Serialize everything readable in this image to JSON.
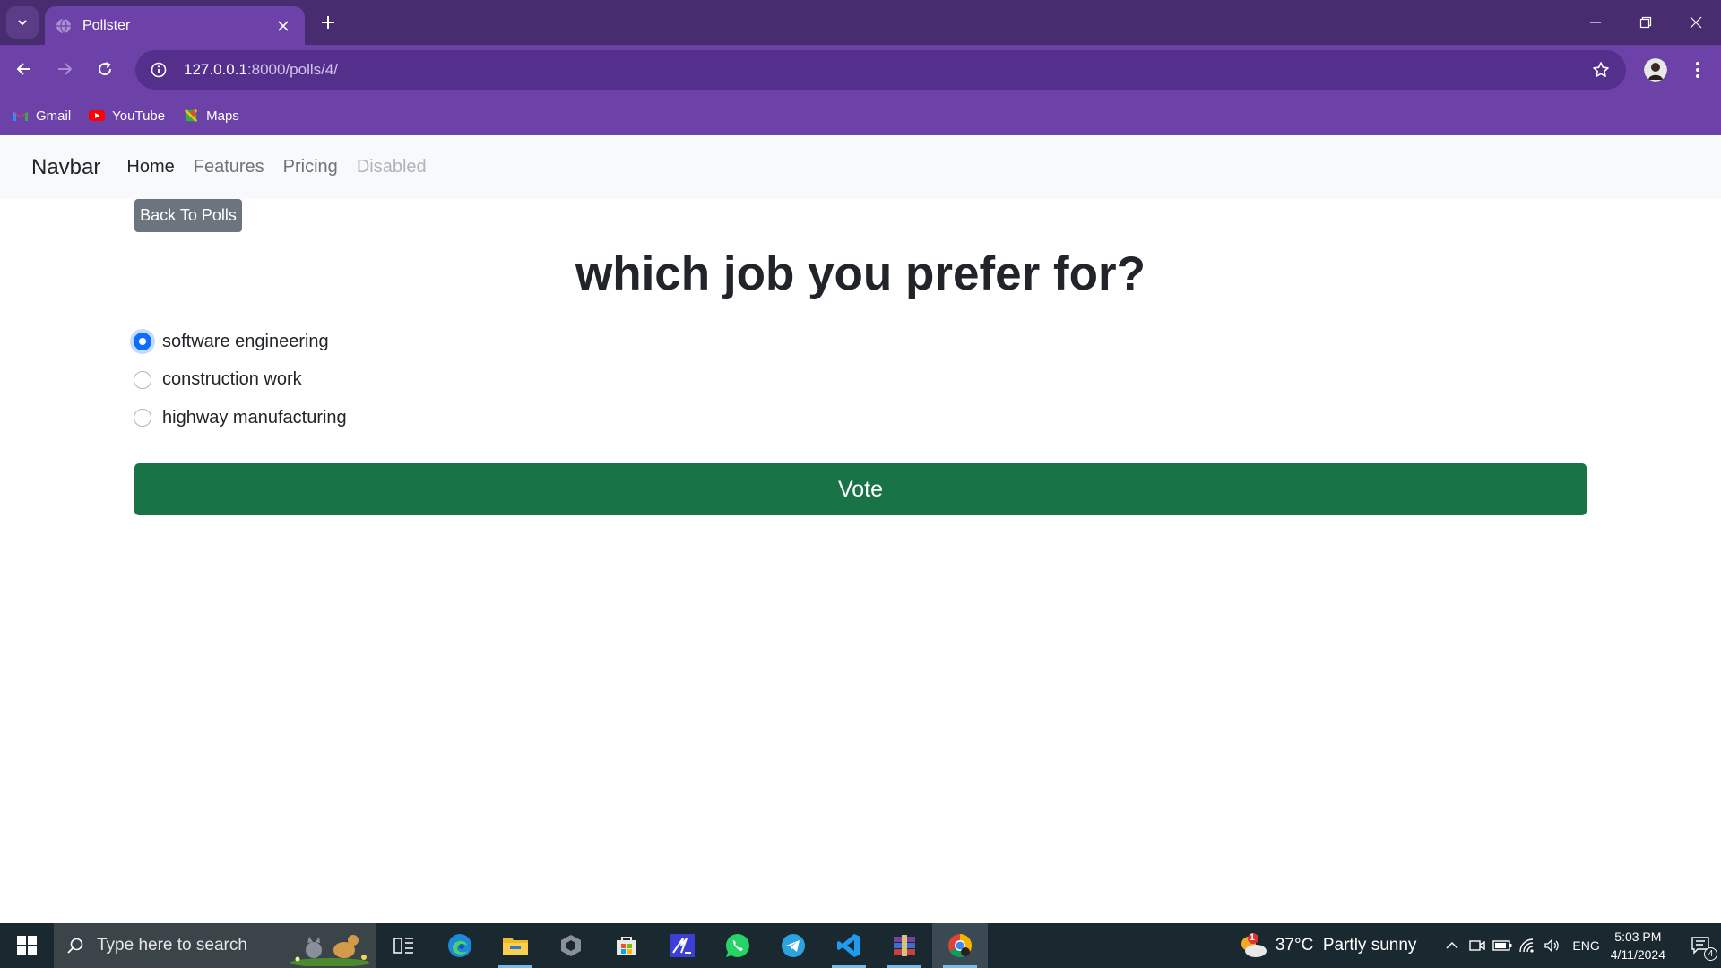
{
  "browser": {
    "tab_title": "Pollster",
    "url_host": "127.0.0.1",
    "url_path": ":8000/polls/4/",
    "bookmarks": [
      {
        "label": "Gmail",
        "icon": "gmail-icon"
      },
      {
        "label": "YouTube",
        "icon": "youtube-icon"
      },
      {
        "label": "Maps",
        "icon": "maps-icon"
      }
    ],
    "colors": {
      "frame": "#472d6f",
      "toolbar": "#6c42a8",
      "omnibox": "#54308c"
    }
  },
  "navbar": {
    "brand": "Navbar",
    "links": [
      {
        "label": "Home",
        "state": "active"
      },
      {
        "label": "Features",
        "state": "normal"
      },
      {
        "label": "Pricing",
        "state": "normal"
      },
      {
        "label": "Disabled",
        "state": "disabled"
      }
    ]
  },
  "page": {
    "back_label": "Back To Polls",
    "question": "which job you prefer for?",
    "options": [
      {
        "label": "software engineering",
        "checked": true
      },
      {
        "label": "construction work",
        "checked": false
      },
      {
        "label": "highway manufacturing",
        "checked": false
      }
    ],
    "vote_label": "Vote",
    "colors": {
      "vote": "#187447",
      "back": "#6c757d",
      "radio_checked": "#0d6efd"
    }
  },
  "taskbar": {
    "search_placeholder": "Type here to search",
    "apps": [
      "task-view-icon",
      "edge-icon",
      "file-explorer-icon",
      "unity-icon",
      "microsoft-store-icon",
      "app-icon",
      "whatsapp-icon",
      "telegram-icon",
      "vscode-icon",
      "winrar-icon",
      "chrome-icon"
    ],
    "weather_badge": "1",
    "weather": "37°C  Partly sunny",
    "language": "ENG",
    "time": "5:03 PM",
    "date": "4/11/2024",
    "notifications": "4"
  }
}
